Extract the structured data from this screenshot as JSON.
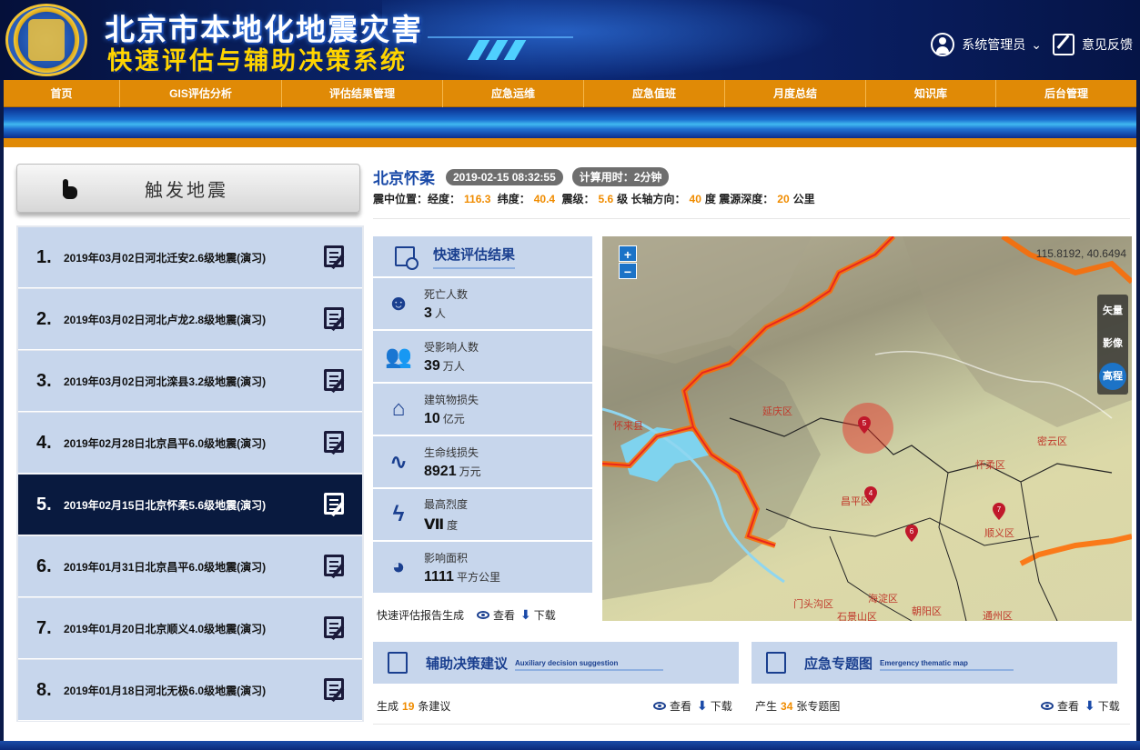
{
  "header": {
    "title_line1": "北京市本地化地震灾害",
    "title_line2": "快速评估与辅助决策系统",
    "user_label": "系统管理员",
    "feedback_label": "意见反馈"
  },
  "nav": [
    {
      "label": "首页"
    },
    {
      "label": "GIS评估分析"
    },
    {
      "label": "评估结果管理"
    },
    {
      "label": "应急运维"
    },
    {
      "label": "应急值班"
    },
    {
      "label": "月度总结"
    },
    {
      "label": "知识库"
    },
    {
      "label": "后台管理"
    }
  ],
  "trigger": {
    "label": "触发地震"
  },
  "quakes": [
    {
      "num": "1.",
      "text": "2019年03月02日河北迁安2.6级地震(演习)",
      "active": false
    },
    {
      "num": "2.",
      "text": "2019年03月02日河北卢龙2.8级地震(演习)",
      "active": false
    },
    {
      "num": "3.",
      "text": "2019年03月02日河北滦县3.2级地震(演习)",
      "active": false
    },
    {
      "num": "4.",
      "text": "2019年02月28日北京昌平6.0级地震(演习)",
      "active": false
    },
    {
      "num": "5.",
      "text": "2019年02月15日北京怀柔5.6级地震(演习)",
      "active": true
    },
    {
      "num": "6.",
      "text": "2019年01月31日北京昌平6.0级地震(演习)",
      "active": false
    },
    {
      "num": "7.",
      "text": "2019年01月20日北京顺义4.0级地震(演习)",
      "active": false
    },
    {
      "num": "8.",
      "text": "2019年01月18日河北无极6.0级地震(演习)",
      "active": false
    }
  ],
  "event": {
    "location": "北京怀柔",
    "time": "2019-02-15 08:32:55",
    "calc_time": "计算用时：2分钟",
    "params_prefix": "震中位置：经度：",
    "lon": "116.3",
    "lat_label": "纬度：",
    "lat": "40.4",
    "mag_label": "震级：",
    "mag": "5.6",
    "mag_unit": "级",
    "axis_label": "长轴方向：",
    "axis": "40",
    "axis_unit": "度",
    "depth_label": "震源深度：",
    "depth": "20",
    "depth_unit": "公里"
  },
  "results": {
    "title": "快速评估结果",
    "items": [
      {
        "label": "死亡人数",
        "value": "3",
        "unit": "人",
        "icon": "skull-icon"
      },
      {
        "label": "受影响人数",
        "value": "39",
        "unit": "万人",
        "icon": "people-icon"
      },
      {
        "label": "建筑物损失",
        "value": "10",
        "unit": "亿元",
        "icon": "house-icon"
      },
      {
        "label": "生命线损失",
        "value": "8921",
        "unit": "万元",
        "icon": "pulse-icon"
      },
      {
        "label": "最高烈度",
        "value": "Ⅶ",
        "unit": "度",
        "icon": "lightning-icon"
      },
      {
        "label": "影响面积",
        "value": "1111",
        "unit": "平方公里",
        "icon": "pie-icon"
      }
    ],
    "report_label": "快速评估报告生成",
    "view_label": "查看",
    "download_label": "下载"
  },
  "map": {
    "coord_readout": "115.8192, 40.6494",
    "zoom_in": "+",
    "zoom_out": "−",
    "layers": [
      "矢量",
      "影像",
      "高程"
    ],
    "active_layer": "高程",
    "places": [
      "延庆区",
      "怀来县",
      "密云区",
      "怀柔区",
      "昌平区",
      "顺义区",
      "海淀区",
      "朝阳区",
      "通州区",
      "门头沟区",
      "石景山区"
    ],
    "markers": [
      "5",
      "4",
      "6",
      "7"
    ]
  },
  "decision": {
    "title": "辅助决策建议",
    "subtitle": "Auxiliary decision suggestion",
    "row_prefix": "生成",
    "count": "19",
    "row_suffix": "条建议",
    "view_label": "查看",
    "download_label": "下载"
  },
  "thematic": {
    "title": "应急专题图",
    "subtitle": "Emergency thematic map",
    "row_prefix": "产生",
    "count": "34",
    "row_suffix": "张专题图",
    "view_label": "查看",
    "download_label": "下载"
  }
}
